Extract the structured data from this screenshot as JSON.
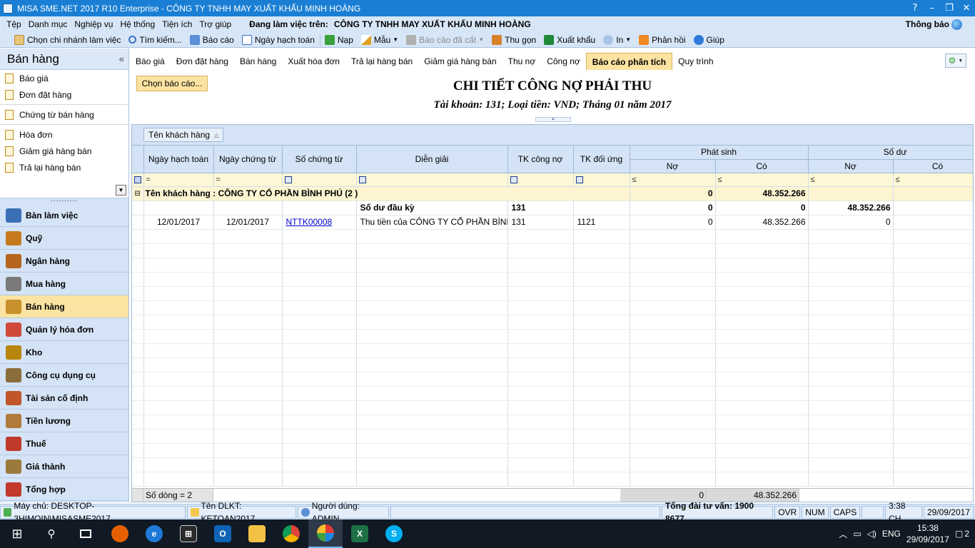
{
  "titlebar": {
    "title": "MISA SME.NET 2017 R10 Enterprise - CÔNG TY TNHH MAY XUẤT KHẨU MINH HOÀNG",
    "buttons": [
      "?",
      "–",
      "❐",
      "✕"
    ]
  },
  "menu": {
    "items": [
      "Tệp",
      "Danh mục",
      "Nghiệp vụ",
      "Hệ thống",
      "Tiện ích",
      "Trợ giúp"
    ],
    "workspace_label": "Đang làm việc trên:",
    "workspace_value": "CÔNG TY TNHH MAY XUẤT KHẨU MINH HOÀNG",
    "notify": "Thông báo"
  },
  "toolbar": {
    "choose_branch": "Chọn chi nhánh làm việc",
    "search": "Tìm kiếm...",
    "report": "Báo cáo",
    "posting_date": "Ngày hạch toán",
    "load": "Nạp",
    "template": "Mẫu",
    "saved_report": "Báo cáo đã cất",
    "collapse": "Thu gọn",
    "export": "Xuất khẩu",
    "print": "In",
    "feedback": "Phản hồi",
    "help": "Giúp"
  },
  "sidebar": {
    "title": "Bán hàng",
    "subitems": [
      {
        "label": "Báo giá"
      },
      {
        "label": "Đơn đặt hàng"
      },
      {
        "label": "Chứng từ bán hàng"
      },
      {
        "label": "Hóa đơn"
      },
      {
        "label": "Giảm giá hàng bán"
      },
      {
        "label": "Trả lại hàng bán"
      }
    ],
    "modules": [
      {
        "label": "Bàn làm việc",
        "color": "#3b6fb6"
      },
      {
        "label": "Quỹ",
        "color": "#c77a1c"
      },
      {
        "label": "Ngân hàng",
        "color": "#b5651d"
      },
      {
        "label": "Mua hàng",
        "color": "#7a7a7a"
      },
      {
        "label": "Bán hàng",
        "color": "#c9902b"
      },
      {
        "label": "Quản lý hóa đơn",
        "color": "#d04a3a"
      },
      {
        "label": "Kho",
        "color": "#b8860b"
      },
      {
        "label": "Công cụ dụng cụ",
        "color": "#8a6d3b"
      },
      {
        "label": "Tài sản cố định",
        "color": "#c0562a"
      },
      {
        "label": "Tiền lương",
        "color": "#b07a3a"
      },
      {
        "label": "Thuế",
        "color": "#c0392b"
      },
      {
        "label": "Giá thành",
        "color": "#9c7a3c"
      },
      {
        "label": "Tổng hợp",
        "color": "#c0392b"
      }
    ]
  },
  "tabs": [
    "Báo giá",
    "Đơn đặt hàng",
    "Bán hàng",
    "Xuất hóa đơn",
    "Trả lại hàng bán",
    "Giảm giá hàng bán",
    "Thu nợ",
    "Công nợ",
    "Báo cáo phân tích",
    "Quy trình"
  ],
  "report": {
    "choose_button": "Chọn báo cáo...",
    "title": "CHI TIẾT CÔNG NỢ PHẢI THU",
    "subtitle": "Tài khoản: 131; Loại tiền: VND; Tháng 01 năm 2017"
  },
  "grid": {
    "group_chip": "Tên khách hàng",
    "columns": {
      "posting_date": "Ngày hạch toán",
      "doc_date": "Ngày chứng từ",
      "doc_no": "Số chứng từ",
      "description": "Diễn giải",
      "debt_account": "TK công nợ",
      "contra_account": "TK đối ứng",
      "arising": "Phát sinh",
      "balance": "Số dư",
      "debit": "Nợ",
      "credit": "Có"
    },
    "filter_ops": {
      "eq": "=",
      "le": "≤"
    },
    "group_row": {
      "label": "Tên khách hàng : CÔNG TY CỔ PHẦN BÌNH PHÚ (2 )",
      "arising_debit": "0",
      "arising_credit": "48.352.266"
    },
    "opening_row": {
      "description": "Số dư đầu kỳ",
      "debt_account": "131",
      "arising_debit": "0",
      "arising_credit": "0",
      "balance_debit": "48.352.266",
      "balance_credit": "0"
    },
    "data_row": {
      "posting_date": "12/01/2017",
      "doc_date": "12/01/2017",
      "doc_no": "NTTK00008",
      "description": "Thu tiền của CÔNG TY CỔ PHẦN BÌNH",
      "debt_account": "131",
      "contra_account": "1121",
      "arising_debit": "0",
      "arising_credit": "48.352.266",
      "balance_debit": "0",
      "balance_credit": "0"
    },
    "footer": {
      "row_count": "Số dòng = 2",
      "arising_debit": "0",
      "arising_credit": "48.352.266"
    }
  },
  "statusbar": {
    "server": "Máy chủ: DESKTOP-3HIMQIN\\MISASME2017",
    "dataset": "Tên DLKT: KETOAN2017",
    "user": "Người dùng: ADMIN",
    "hotline": "Tổng đài tư vấn: 1900 8677",
    "ovr": "OVR",
    "num": "NUM",
    "caps": "CAPS",
    "time": "3:38 CH",
    "date": "29/09/2017"
  },
  "taskbar": {
    "lang": "ENG",
    "time": "15:38",
    "date": "29/09/2017",
    "notifications": "2"
  }
}
